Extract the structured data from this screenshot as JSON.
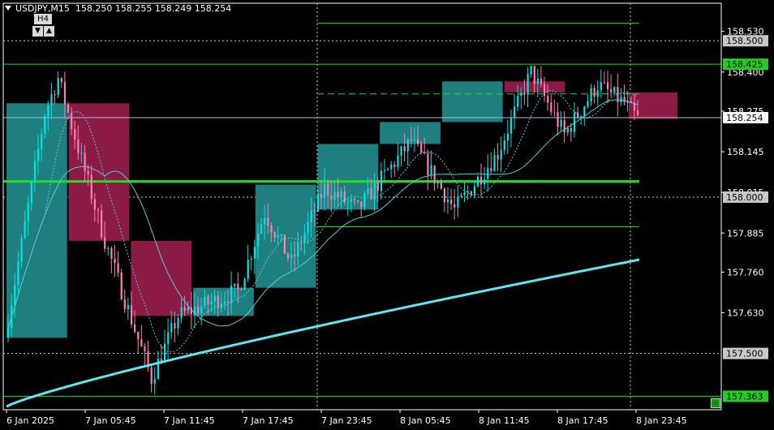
{
  "header": {
    "symbol_tf": "USDJPY,M15",
    "ohlc": "158.250 158.255 158.249 158.254"
  },
  "tf_widget": {
    "label": "H4",
    "down": "▼",
    "up": "▲"
  },
  "minus_button": "-",
  "colors": {
    "background": "#000000",
    "bull_body": "#00e5e5",
    "bear_body": "#ff7fb2",
    "h4_bull_box": "#1f7f7f",
    "h4_bear_box": "#8b1a45",
    "level_line": "#22dd22",
    "ma_fast": "#4fd0d0",
    "ma_slow": "#5ce8f0",
    "price_line": "#aebfd8"
  },
  "price_axis": {
    "min": 157.32,
    "max": 158.62,
    "ticks": [
      "158.530",
      "158.400",
      "158.275",
      "158.145",
      "158.015",
      "157.885",
      "157.760",
      "157.630"
    ],
    "labels": [
      {
        "text": "158.500",
        "price": 158.5,
        "bg": "#c8c8c8",
        "fg": "#000000"
      },
      {
        "text": "158.425",
        "price": 158.425,
        "bg": "#22cc22",
        "fg": "#000000"
      },
      {
        "text": "158.254",
        "price": 158.254,
        "bg": "#ffffff",
        "fg": "#000000"
      },
      {
        "text": "158.000",
        "price": 158.0,
        "bg": "#c8c8c8",
        "fg": "#000000"
      },
      {
        "text": "157.500",
        "price": 157.5,
        "bg": "#c8c8c8",
        "fg": "#000000"
      },
      {
        "text": "157.363",
        "price": 157.363,
        "bg": "#22cc22",
        "fg": "#000000"
      }
    ]
  },
  "time_axis": {
    "labels": [
      "6 Jan 2025",
      "7 Jan 05:45",
      "7 Jan 11:45",
      "7 Jan 17:45",
      "7 Jan 23:45",
      "8 Jan 05:45",
      "8 Jan 11:45",
      "8 Jan 17:45",
      "8 Jan 23:45"
    ]
  },
  "levels": [
    {
      "price": 158.556,
      "style": "solid"
    },
    {
      "price": 158.425,
      "style": "solid"
    },
    {
      "price": 158.33,
      "style": "dash"
    },
    {
      "price": 158.05,
      "style": "thick"
    },
    {
      "price": 157.905,
      "style": "solid"
    },
    {
      "price": 157.363,
      "style": "solid"
    }
  ],
  "grid_prices": [
    158.5,
    158.0,
    157.5
  ],
  "current_price": 158.254,
  "h4_boxes": [
    {
      "open": 157.55,
      "close": 158.3,
      "bull": true
    },
    {
      "open": 158.3,
      "close": 157.86,
      "bull": false
    },
    {
      "open": 157.86,
      "close": 157.62,
      "bull": false
    },
    {
      "open": 157.62,
      "close": 157.71,
      "bull": true
    },
    {
      "open": 157.71,
      "close": 158.04,
      "bull": true
    },
    {
      "open": 157.96,
      "close": 158.17,
      "bull": true
    },
    {
      "open": 158.17,
      "close": 158.24,
      "bull": true
    },
    {
      "open": 158.24,
      "close": 158.37,
      "bull": true
    },
    {
      "open": 158.37,
      "close": 158.335,
      "bull": false
    },
    {
      "open": 158.335,
      "close": 158.25,
      "bull": false
    }
  ]
}
